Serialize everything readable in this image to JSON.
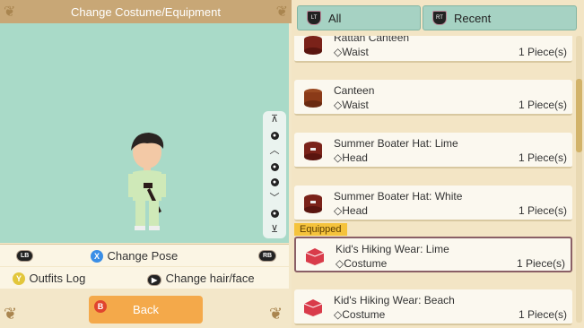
{
  "header": {
    "title": "Change Costume/Equipment"
  },
  "side_toolbar": {
    "top": "⊼",
    "bottom": "⊻"
  },
  "controls": {
    "lb": "LB",
    "rb": "RB",
    "lt": "LT",
    "rt": "RT",
    "change_pose_button": "X",
    "change_pose_label": "Change Pose",
    "outfits_button": "Y",
    "outfits_label": "Outfits Log",
    "hair_label": "Change hair/face",
    "back_button": "B",
    "back_label": "Back"
  },
  "tabs": [
    {
      "label": "All"
    },
    {
      "label": "Recent"
    }
  ],
  "equipped_label": "Equipped",
  "items": [
    {
      "name": "Rattan Canteen",
      "slot": "◇Waist",
      "count": "1 Piece(s)"
    },
    {
      "name": "Canteen",
      "slot": "◇Waist",
      "count": "1 Piece(s)"
    },
    {
      "name": "Summer Boater Hat: Lime",
      "slot": "◇Head",
      "count": "1 Piece(s)"
    },
    {
      "name": "Summer Boater Hat: White",
      "slot": "◇Head",
      "count": "1 Piece(s)"
    },
    {
      "name": "Kid's Hiking Wear: Lime",
      "slot": "◇Costume",
      "count": "1 Piece(s)"
    },
    {
      "name": "Kid's Hiking Wear: Beach",
      "slot": "◇Costume",
      "count": "1 Piece(s)"
    }
  ],
  "colors": {
    "preview_bg": "#a9dac8",
    "accent": "#f4a94a",
    "tab": "#a6d2c3"
  }
}
